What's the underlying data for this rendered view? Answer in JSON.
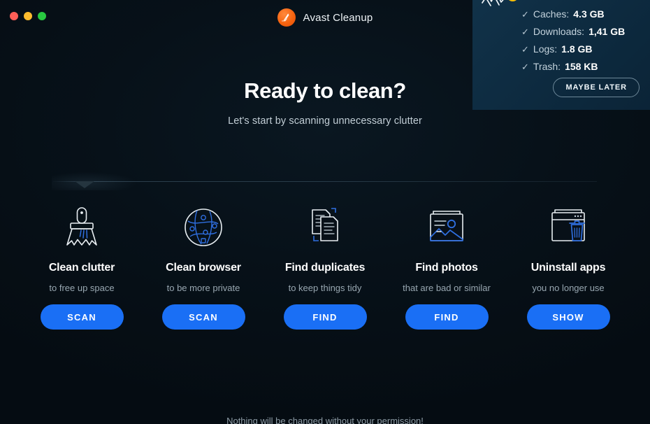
{
  "window": {
    "title": "Avast Cleanup",
    "logo_icon": "avast-logo-icon",
    "traffic_lights": [
      {
        "name": "close",
        "color": "#ff5f57"
      },
      {
        "name": "minimize",
        "color": "#febc2e"
      },
      {
        "name": "maximize",
        "color": "#28c840"
      }
    ],
    "background_color": "#050c12"
  },
  "hero": {
    "title": "Ready to clean?",
    "subtitle": "Let's start by scanning unnecessary clutter"
  },
  "cards": [
    {
      "icon": "brush-icon",
      "title": "Clean clutter",
      "subtitle": "to free up space",
      "button": "SCAN"
    },
    {
      "icon": "globe-network-icon",
      "title": "Clean browser",
      "subtitle": "to be more private",
      "button": "SCAN"
    },
    {
      "icon": "duplicate-documents-icon",
      "title": "Find duplicates",
      "subtitle": "to keep things tidy",
      "button": "FIND"
    },
    {
      "icon": "photo-icon",
      "title": "Find photos",
      "subtitle": "that are bad or similar",
      "button": "FIND"
    },
    {
      "icon": "window-trash-icon",
      "title": "Uninstall apps",
      "subtitle": "you no longer use",
      "button": "SHOW"
    }
  ],
  "footer": {
    "note": "Nothing will be changed without your permission!"
  },
  "notification": {
    "icon": "cleanup-alert-icon",
    "badge": "!",
    "badge_color": "#ffc107",
    "background_color": "#0d2a3f",
    "check_glyph": "✓",
    "items": [
      {
        "label": "Caches:",
        "value": "4.3 GB"
      },
      {
        "label": "Downloads:",
        "value": "1,41 GB"
      },
      {
        "label": "Logs:",
        "value": "1.8 GB"
      },
      {
        "label": "Trash:",
        "value": "158 KB"
      }
    ],
    "dismiss_button": "MAYBE LATER"
  },
  "theme": {
    "accent_blue": "#1a6ff5",
    "title_text": "#ffffff",
    "muted_text": "#98a7b1"
  }
}
